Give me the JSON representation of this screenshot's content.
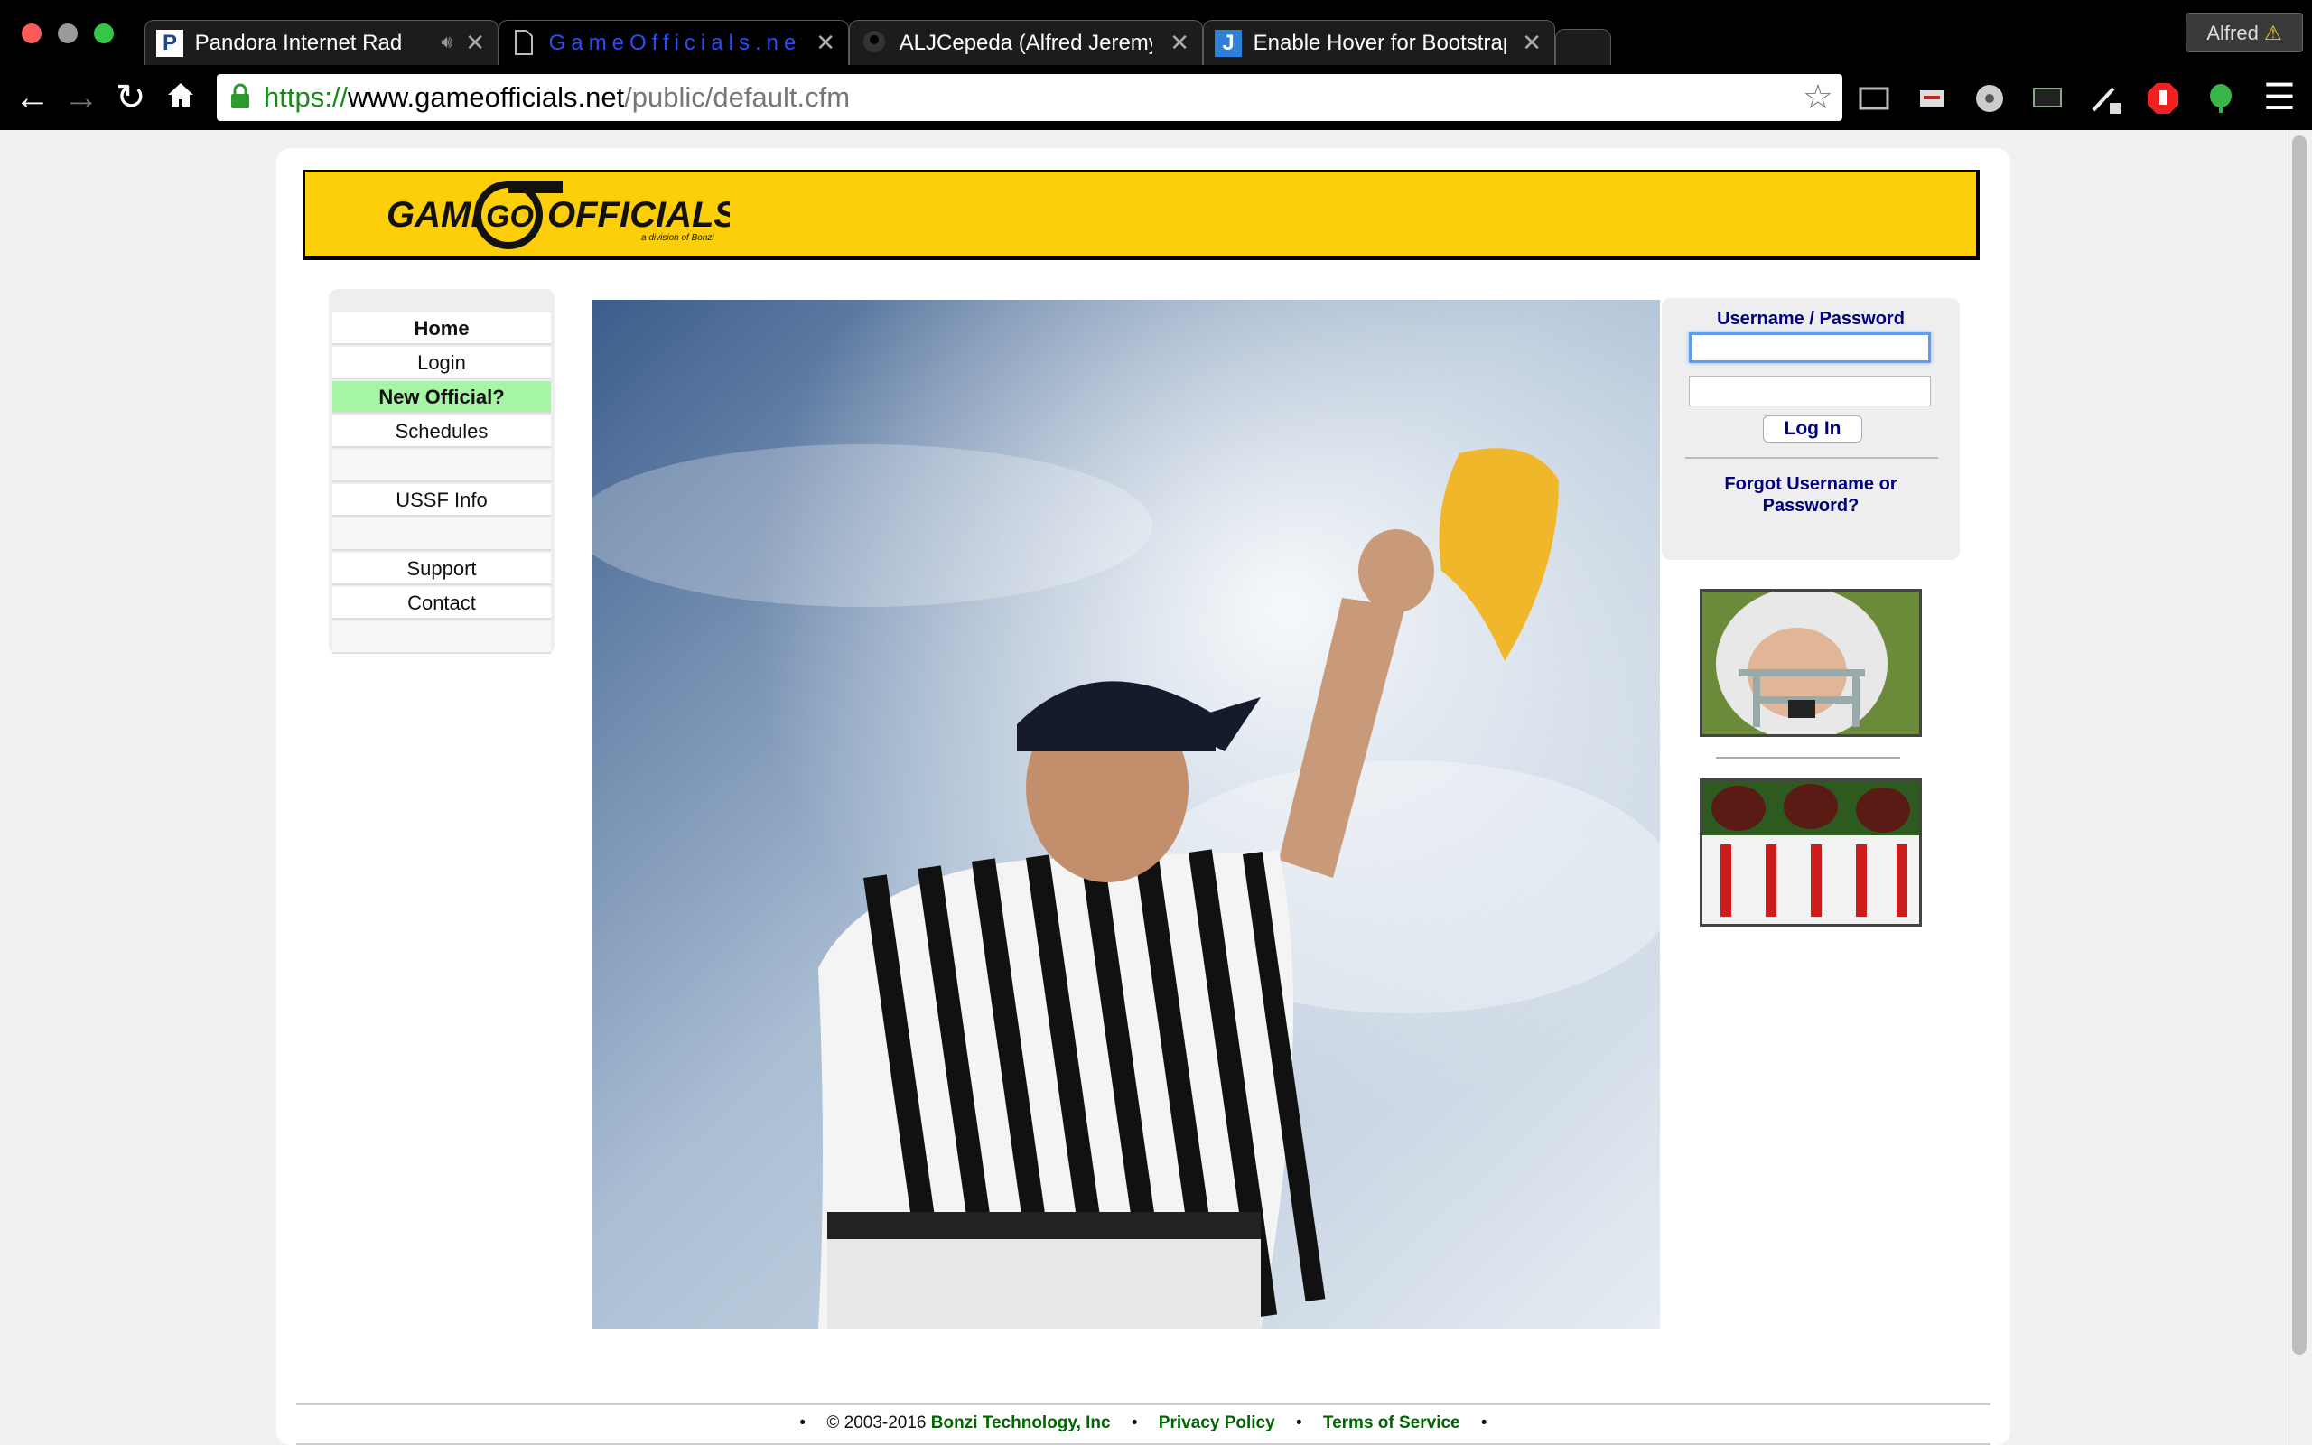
{
  "browser": {
    "tabs": [
      {
        "title": "Pandora Internet Radio",
        "favicon": "P"
      },
      {
        "title": "GameOfficials.net",
        "favicon": ""
      },
      {
        "title": "ALJCepeda (Alfred Jeremy",
        "favicon": ""
      },
      {
        "title": "Enable Hover for Bootstrap",
        "favicon": "J"
      }
    ],
    "profile_name": "Alfred",
    "profile_warning": "⚠",
    "url_scheme": "https://",
    "url_host": "www.gameofficials.net",
    "url_path": "/public/default.cfm",
    "close_glyph": "✕"
  },
  "page": {
    "nav": {
      "items": [
        {
          "label": "Home"
        },
        {
          "label": "Login"
        },
        {
          "label": "New Official?"
        },
        {
          "label": "Schedules"
        },
        {
          "label": "USSF Info"
        },
        {
          "label": "Support"
        },
        {
          "label": "Contact"
        }
      ]
    },
    "login": {
      "heading": "Username / Password",
      "username_value": "",
      "password_value": "",
      "button_label": "Log In",
      "forgot_label": "Forgot Username or Password?"
    },
    "footer": {
      "copyright": "© 2003-2016",
      "company": "Bonzi Technology, Inc",
      "privacy": "Privacy Policy",
      "terms": "Terms of Service",
      "bullet": "•"
    }
  },
  "colors": {
    "banner": "#fdce0a",
    "nav_highlight": "#a6f5a6",
    "login_text": "#000080",
    "footer_link": "#006600",
    "active_tab_text": "#2a4cff"
  }
}
